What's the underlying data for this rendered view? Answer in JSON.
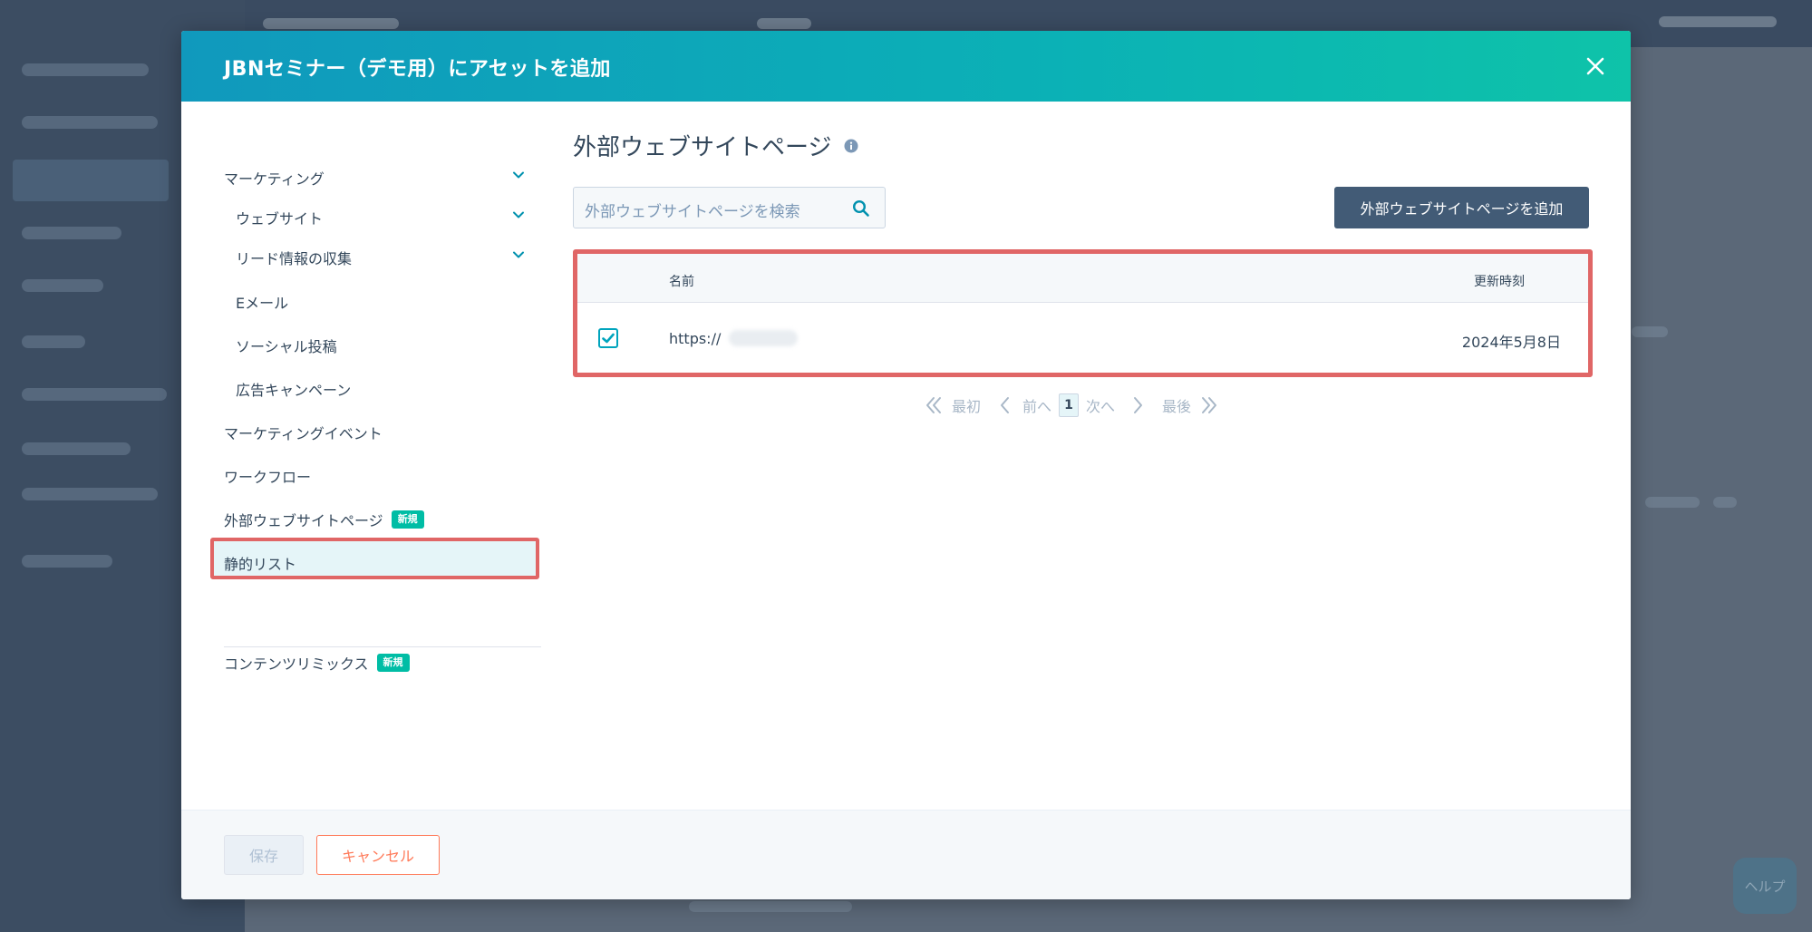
{
  "modal": {
    "title": "JBNセミナー（デモ用）にアセットを追加"
  },
  "nav": {
    "items": [
      {
        "label": "マーケティング",
        "expanded": true
      },
      {
        "label": "ウェブサイト",
        "expanded": true
      },
      {
        "label": "リード情報の収集",
        "expanded": true
      },
      {
        "label": "Eメール"
      },
      {
        "label": "ソーシャル投稿"
      },
      {
        "label": "広告キャンペーン"
      },
      {
        "label": "マーケティングイベント"
      },
      {
        "label": "ワークフロー"
      },
      {
        "label": "外部ウェブサイトページ",
        "badge": "新規",
        "selected": true
      },
      {
        "label": "静的リスト"
      },
      {
        "label": "コンテンツリミックス",
        "badge": "新規"
      }
    ]
  },
  "panel": {
    "title": "外部ウェブサイトページ",
    "search_placeholder": "外部ウェブサイトページを検索",
    "add_button": "外部ウェブサイトページを追加"
  },
  "table": {
    "columns": [
      "名前",
      "更新時刻"
    ],
    "rows": [
      {
        "checked": true,
        "name": "https://",
        "updated": "2024年5月8日"
      }
    ]
  },
  "pagination": {
    "first": "最初",
    "prev": "前へ",
    "current": "1",
    "next": "次へ",
    "last": "最後"
  },
  "footer": {
    "save": "保存",
    "cancel": "キャンセル"
  },
  "background": {
    "help": "ヘルプ"
  },
  "colors": {
    "header_start": "#1099bd",
    "header_end": "#0ec3a9",
    "highlight_border": "#e06666",
    "badge": "#00bda5",
    "primary_button": "#425b76",
    "cancel_accent": "#ff7a59",
    "text": "#33475b"
  }
}
